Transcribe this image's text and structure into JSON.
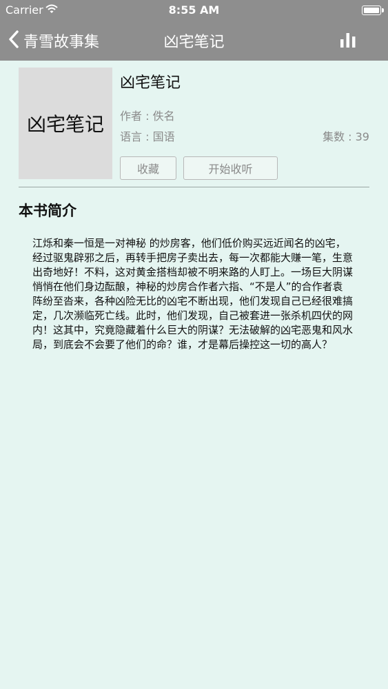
{
  "status_bar": {
    "carrier": "Carrier",
    "time": "8:55 AM"
  },
  "nav": {
    "back_label": "青雪故事集",
    "title": "凶宅笔记",
    "icons": {
      "back": "chevron-left-icon",
      "right": "bar-chart-icon"
    }
  },
  "book": {
    "cover_text": "凶宅笔记",
    "title": "凶宅笔记",
    "author": "作者 : 佚名",
    "language": "语言 : 国语",
    "episodes": "集数 : 39"
  },
  "actions": {
    "collect_label": "收藏",
    "listen_label": "开始收听"
  },
  "intro": {
    "heading": "本书简介",
    "text": "江烁和秦一恒是一对神秘 的炒房客，他们低价购买远近闻名的凶宅，经过驱鬼辟邪之后，再转手把房子卖出去，每一次都能大赚一笔，生意出奇地好！不料，这对黄金搭档却被不明来路的人盯上。一场巨大阴谋悄悄在他们身边酝酿，神秘的炒房合作者六指、“不是人”的合作者袁阵纷至沓来，各种凶险无比的凶宅不断出现，他们发现自己已经很难搞定，几次濒临死亡线。此时，他们发现，自己被套进一张杀机四伏的网内！这其中，究竟隐藏着什么巨大的阴谋？无法破解的凶宅恶鬼和风水局，到底会不会要了他们的命？谁，才是幕后操控这一切的高人？"
  },
  "colors": {
    "nav_background": "#8e8e8e",
    "page_background": "#e5f5f1",
    "cover_background": "#dcdcdc",
    "meta_text": "#8a8a8a"
  }
}
